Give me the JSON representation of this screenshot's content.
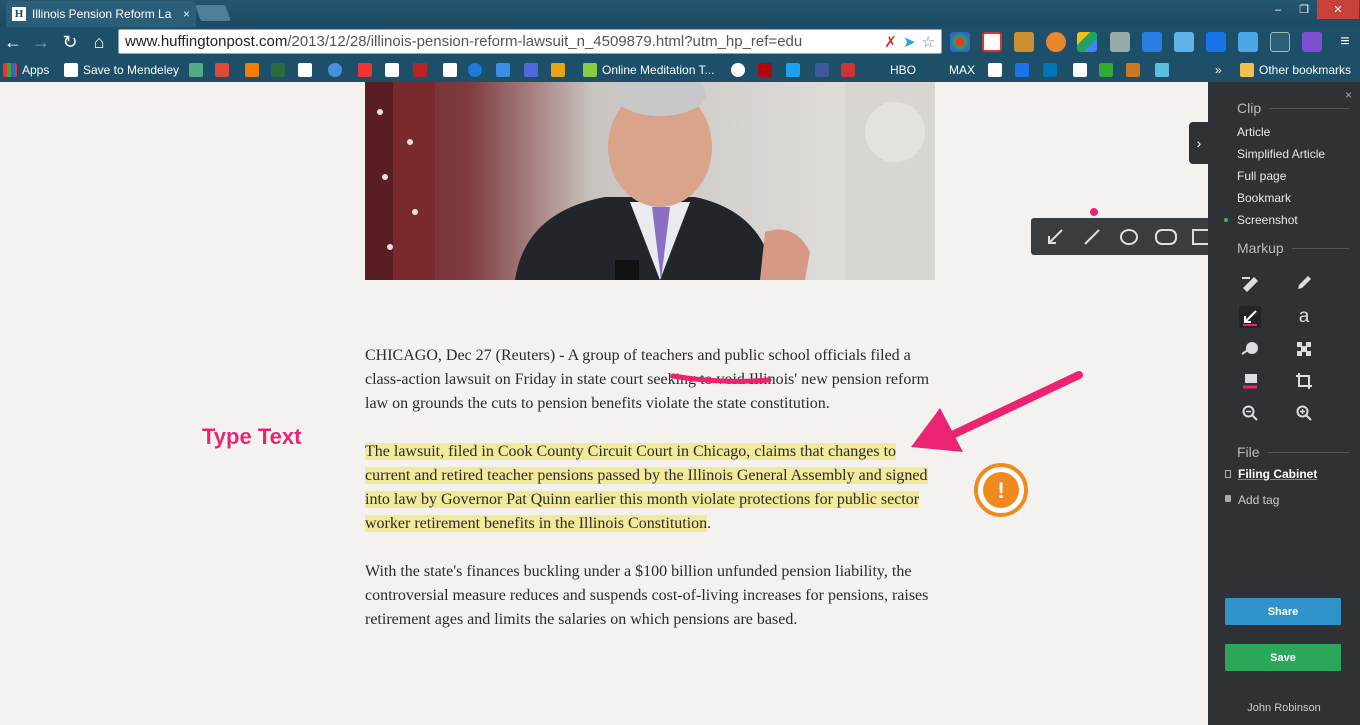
{
  "browser": {
    "tab_title": "Illinois Pension Reform La",
    "tab_favicon": "H",
    "tab_close": "×",
    "url_main": "www.huffingtonpost.com",
    "url_rest": "/2013/12/28/illinois-pension-reform-lawsuit_n_4509879.html?utm_hp_ref=edu",
    "window_controls": {
      "minimize": "‒",
      "maximize": "❐",
      "close": "✕"
    }
  },
  "bookmarks": {
    "apps": "Apps",
    "mendeley": "Save to Mendeley",
    "meditation": "Online Meditation T...",
    "hbo": "HBO",
    "max": "MAX",
    "overflow": "»",
    "other": "Other bookmarks"
  },
  "article": {
    "paragraph1": "CHICAGO, Dec 27 (Reuters) - A group of teachers and public school officials filed a class-action lawsuit on Friday in state court seeking to void Illinois' new pension reform law on grounds the cuts to pension benefits violate the state constitution.",
    "paragraph2_highlighted": "The lawsuit, filed in Cook County Circuit Court in Chicago, claims that changes to current and retired teacher pensions passed by the Illinois General Assembly and signed into law by Governor Pat Quinn earlier this month violate protections for public sector worker retirement benefits in the Illinois Constitution",
    "paragraph2_end": ".",
    "paragraph3": "With the state's finances buckling under a $100 billion unfunded pension liability, the controversial measure reduces and suspends cost-of-living increases for pensions, raises retirement ages and limits the salaries on which pensions are based."
  },
  "annotations": {
    "type_text": "Type Text",
    "stamp_symbol": "!",
    "accent_color": "#ea2470",
    "stamp_color": "#f08a1e"
  },
  "panel": {
    "clip_heading": "Clip",
    "clip_options": [
      "Article",
      "Simplified Article",
      "Full page",
      "Bookmark",
      "Screenshot"
    ],
    "selected_clip": "Screenshot",
    "markup_heading": "Markup",
    "file_heading": "File",
    "notebook": "Filing Cabinet",
    "add_tag": "Add tag",
    "share": "Share",
    "save": "Save",
    "user": "John Robinson",
    "close": "×",
    "collapse": "›"
  }
}
